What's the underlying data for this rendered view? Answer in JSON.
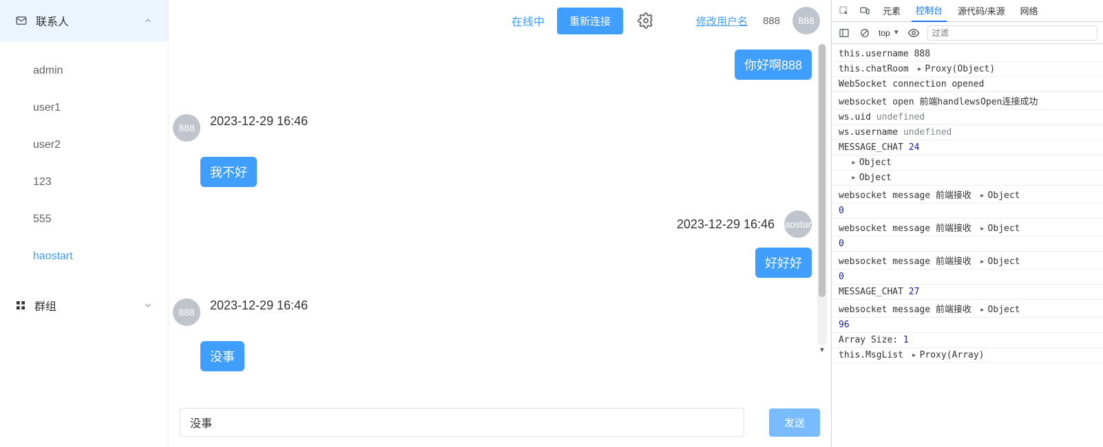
{
  "sidebar": {
    "contacts_label": "联系人",
    "groups_label": "群组",
    "items": [
      {
        "label": "admin"
      },
      {
        "label": "user1"
      },
      {
        "label": "user2"
      },
      {
        "label": "123"
      },
      {
        "label": "555"
      },
      {
        "label": "haostart"
      }
    ],
    "selected_index": 5
  },
  "topbar": {
    "online_label": "在线中",
    "reconnect_label": "重新连接",
    "modify_user_label": "修改用户名",
    "username": "888",
    "avatar_text": "888"
  },
  "messages": [
    {
      "side": "right",
      "bubble": "你好啊888"
    },
    {
      "side": "left",
      "avatar": "888",
      "time": "2023-12-29 16:46",
      "bubble": "我不好"
    },
    {
      "side": "right",
      "avatar": "aostar",
      "time": "2023-12-29 16:46",
      "bubble": "好好好"
    },
    {
      "side": "left",
      "avatar": "888",
      "time": "2023-12-29 16:46",
      "bubble": "没事"
    }
  ],
  "compose": {
    "value": "没事",
    "send_label": "发送"
  },
  "devtools": {
    "tabs": {
      "elements": "元素",
      "console": "控制台",
      "sources": "源代码/来源",
      "network": "网络"
    },
    "toolbar": {
      "top_label": "top",
      "filter_placeholder": "过滤"
    },
    "logs": [
      {
        "text": "this.username 888"
      },
      {
        "prefix": "this.chatRoom",
        "expand": true,
        "suffix": "Proxy(Object)"
      },
      {
        "text": "WebSocket connection opened"
      },
      {
        "text": "websocket open 前端handlewsOpen连接成功"
      },
      {
        "prefix": "ws.uid",
        "undef": "undefined"
      },
      {
        "prefix": "ws.username",
        "undef": "undefined"
      },
      {
        "prefix": "MESSAGE_CHAT",
        "num": "24"
      },
      {
        "indent": true,
        "expand": true,
        "suffix": "Object"
      },
      {
        "indent": true,
        "expand": true,
        "suffix": "Object"
      },
      {
        "prefix": "websocket message 前端接收",
        "expand": true,
        "suffix": "Object"
      },
      {
        "num": "0"
      },
      {
        "prefix": "websocket message 前端接收",
        "expand": true,
        "suffix": "Object"
      },
      {
        "num": "0"
      },
      {
        "prefix": "websocket message 前端接收",
        "expand": true,
        "suffix": "Object"
      },
      {
        "num": "0"
      },
      {
        "prefix": "MESSAGE_CHAT",
        "num": "27"
      },
      {
        "prefix": "websocket message 前端接收",
        "expand": true,
        "suffix": "Object"
      },
      {
        "num": "96"
      },
      {
        "prefix": "Array Size:",
        "num": "1"
      },
      {
        "prefix": "this.MsgList",
        "expand": true,
        "suffix": "Proxy(Array)"
      }
    ]
  }
}
